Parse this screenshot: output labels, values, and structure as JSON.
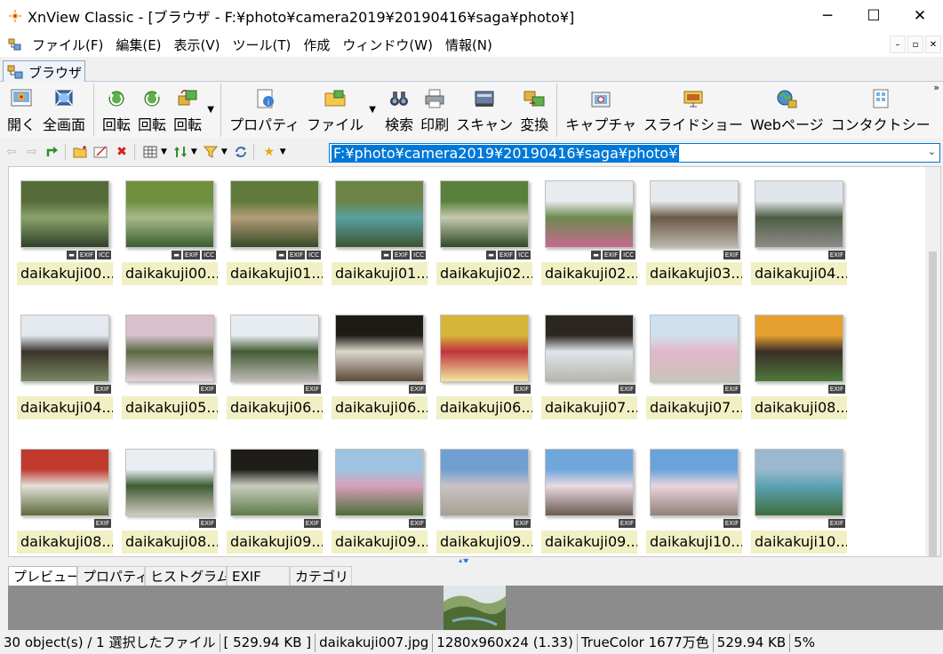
{
  "window": {
    "title": "XnView Classic - [ブラウザ - F:¥photo¥camera2019¥20190416¥saga¥photo¥]",
    "minimize": "─",
    "maximize": "☐",
    "close": "✕"
  },
  "menu": [
    "ファイル(F)",
    "編集(E)",
    "表示(V)",
    "ツール(T)",
    "作成",
    "ウィンドウ(W)",
    "情報(N)"
  ],
  "mdi": {
    "minimize": "–",
    "restore": "▫",
    "close": "✕"
  },
  "tab": {
    "label": "ブラウザ"
  },
  "toolbar": {
    "open": "開く",
    "fullscreen": "全画面",
    "rotate_left": "回転",
    "rotate_right": "回転",
    "rotate": "回転",
    "properties": "プロパティ",
    "file": "ファイル",
    "search": "検索",
    "print": "印刷",
    "scan": "スキャン",
    "convert": "変換",
    "capture": "キャプチャ",
    "slideshow": "スライドショー",
    "webpage": "Webページ",
    "contact": "コンタクトシー",
    "more": "»"
  },
  "address": {
    "path": "F:¥photo¥camera2019¥20190416¥saga¥photo¥"
  },
  "thumbnails": [
    {
      "name": "daikakuji00...",
      "badges": [
        "▬",
        "EXIF",
        "ICC"
      ],
      "colors": [
        "#556b3a",
        "#8aa36a",
        "#2f3f2a"
      ]
    },
    {
      "name": "daikakuji00...",
      "badges": [
        "▬",
        "EXIF",
        "ICC"
      ],
      "colors": [
        "#6f8f3e",
        "#a7b98a",
        "#3b5c2d"
      ]
    },
    {
      "name": "daikakuji01...",
      "badges": [
        "▬",
        "EXIF",
        "ICC"
      ],
      "colors": [
        "#5f7a3a",
        "#b39d7a",
        "#364a26"
      ]
    },
    {
      "name": "daikakuji01...",
      "badges": [
        "▬",
        "EXIF",
        "ICC"
      ],
      "colors": [
        "#6c8446",
        "#5aa0a0",
        "#3d5430"
      ]
    },
    {
      "name": "daikakuji02...",
      "badges": [
        "▬",
        "EXIF",
        "ICC"
      ],
      "colors": [
        "#58813c",
        "#c6c9b0",
        "#2e4a25"
      ]
    },
    {
      "name": "daikakuji02...",
      "badges": [
        "▬",
        "EXIF",
        "ICC"
      ],
      "colors": [
        "#e8ecef",
        "#6c8a4d",
        "#c56a8e"
      ]
    },
    {
      "name": "daikakuji03...",
      "badges": [
        "EXIF"
      ],
      "colors": [
        "#e6eaee",
        "#6b5a48",
        "#bcb6ad"
      ]
    },
    {
      "name": "daikakuji04...",
      "badges": [
        "EXIF"
      ],
      "colors": [
        "#dfe5ea",
        "#4d5e44",
        "#8e8c88"
      ]
    },
    {
      "name": "daikakuji04...",
      "badges": [
        "EXIF"
      ],
      "colors": [
        "#e3e9ee",
        "#3a342c",
        "#7a8860"
      ]
    },
    {
      "name": "daikakuji05...",
      "badges": [
        "EXIF"
      ],
      "colors": [
        "#d8c0cc",
        "#5a6a42",
        "#e6d3de"
      ]
    },
    {
      "name": "daikakuji06...",
      "badges": [
        "EXIF"
      ],
      "colors": [
        "#e6ecf0",
        "#445c36",
        "#bdbbb5"
      ]
    },
    {
      "name": "daikakuji06...",
      "badges": [
        "EXIF"
      ],
      "colors": [
        "#1e1b17",
        "#dcd8cc",
        "#5b4a38"
      ]
    },
    {
      "name": "daikakuji06...",
      "badges": [
        "EXIF"
      ],
      "colors": [
        "#d7b53a",
        "#c0343b",
        "#f2e6a0"
      ]
    },
    {
      "name": "daikakuji07...",
      "badges": [
        "EXIF"
      ],
      "colors": [
        "#2b2620",
        "#dfe6ec",
        "#b8b4ab"
      ]
    },
    {
      "name": "daikakuji07...",
      "badges": [
        "EXIF"
      ],
      "colors": [
        "#cfe0ef",
        "#e2b7c8",
        "#c9c4ba"
      ]
    },
    {
      "name": "daikakuji08...",
      "badges": [
        "EXIF"
      ],
      "colors": [
        "#e6a030",
        "#3b2e28",
        "#4c7a3a"
      ]
    },
    {
      "name": "daikakuji08...",
      "badges": [
        "EXIF"
      ],
      "colors": [
        "#c03a2e",
        "#e4e1da",
        "#5c6a3a"
      ]
    },
    {
      "name": "daikakuji08...",
      "badges": [
        "EXIF"
      ],
      "colors": [
        "#e8eef2",
        "#3f5a34",
        "#d1cbbe"
      ]
    },
    {
      "name": "daikakuji09...",
      "badges": [
        "EXIF"
      ],
      "colors": [
        "#1f1d1a",
        "#c9cdbf",
        "#5d7a48"
      ]
    },
    {
      "name": "daikakuji09...",
      "badges": [
        "EXIF"
      ],
      "colors": [
        "#9dc3e0",
        "#d9a0bb",
        "#4b6e38"
      ]
    },
    {
      "name": "daikakuji09...",
      "badges": [
        "EXIF"
      ],
      "colors": [
        "#6f9fd0",
        "#c8c2c6",
        "#a6a092"
      ]
    },
    {
      "name": "daikakuji09...",
      "badges": [
        "EXIF"
      ],
      "colors": [
        "#6fa6dc",
        "#e9d9e1",
        "#6a5a50"
      ]
    },
    {
      "name": "daikakuji10...",
      "badges": [
        "EXIF"
      ],
      "colors": [
        "#6aa2dc",
        "#ead4de",
        "#8f8078"
      ]
    },
    {
      "name": "daikakuji10...",
      "badges": [
        "EXIF"
      ],
      "colors": [
        "#9cb8cf",
        "#5aa3b3",
        "#3f6d3c"
      ]
    }
  ],
  "bottom_tabs": [
    "プレビュー",
    "プロパティ",
    "ヒストグラム",
    "EXIF",
    "カテゴリ"
  ],
  "status": {
    "objects": "30 object(s) / 1 選択したファイル",
    "selected_size": "[ 529.94 KB ]",
    "filename": "daikakuji007.jpg",
    "dimensions": "1280x960x24 (1.33)",
    "colors": "TrueColor 1677万色",
    "filesize": "529.94 KB",
    "zoom": "5%"
  }
}
